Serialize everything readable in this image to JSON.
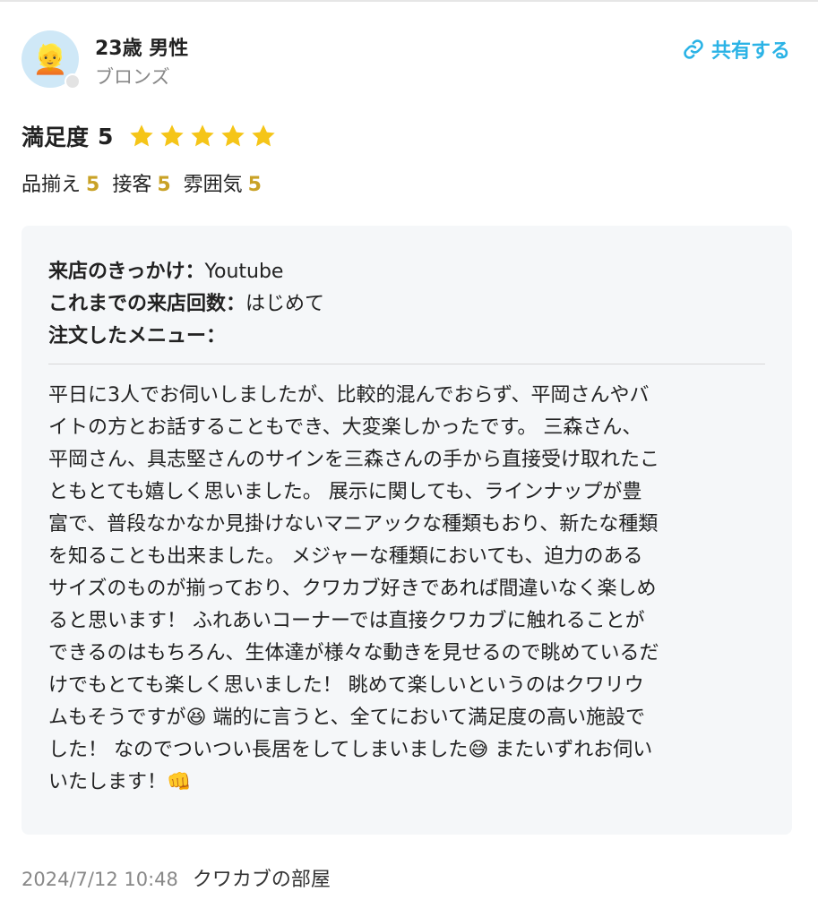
{
  "reviewer": {
    "avatar_emoji": "👱",
    "name": "23歳 男性",
    "rank": "ブロンズ"
  },
  "share": {
    "label": "共有する",
    "icon": "link-icon",
    "color": "#2bb3e6"
  },
  "satisfaction": {
    "label": "満足度",
    "value": "5",
    "stars": 5,
    "star_color": "#f5c518"
  },
  "subratings": [
    {
      "label": "品揃え",
      "score": "5"
    },
    {
      "label": "接客",
      "score": "5"
    },
    {
      "label": "雰囲気",
      "score": "5"
    }
  ],
  "meta": {
    "trigger_label": "来店のきっかけ：",
    "trigger_value": "Youtube",
    "visits_label": "これまでの来店回数：",
    "visits_value": "はじめて",
    "menu_label": "注文したメニュー：",
    "menu_value": ""
  },
  "review_text": "平日に3人でお伺いしましたが、比較的混んでおらず、平岡さんやバ\nイトの方とお話することもでき、大変楽しかったです。 三森さん、\n平岡さん、具志堅さんのサインを三森さんの手から直接受け取れたこ\nともとても嬉しく思いました。 展示に関しても、ラインナップが豊\n富で、普段なかなか見掛けないマニアックな種類もおり、新たな種類\nを知ることも出来ました。 メジャーな種類においても、迫力のある\nサイズのものが揃っており、クワカブ好きであれば間違いなく楽しめ\nると思います！ ふれあいコーナーでは直接クワカブに触れることが\nできるのはもちろん、生体達が様々な動きを見せるので眺めているだ\nけでもとても楽しく思いました！ 眺めて楽しいというのはクワリウ\nムもそうですが😆 端的に言うと、全てにおいて満足度の高い施設で\nした！ なのでついつい長居をしてしまいました😅 またいずれお伺い\nいたします！👊",
  "footer": {
    "date": "2024/7/12 10:48",
    "shop_name": "クワカブの部屋"
  }
}
